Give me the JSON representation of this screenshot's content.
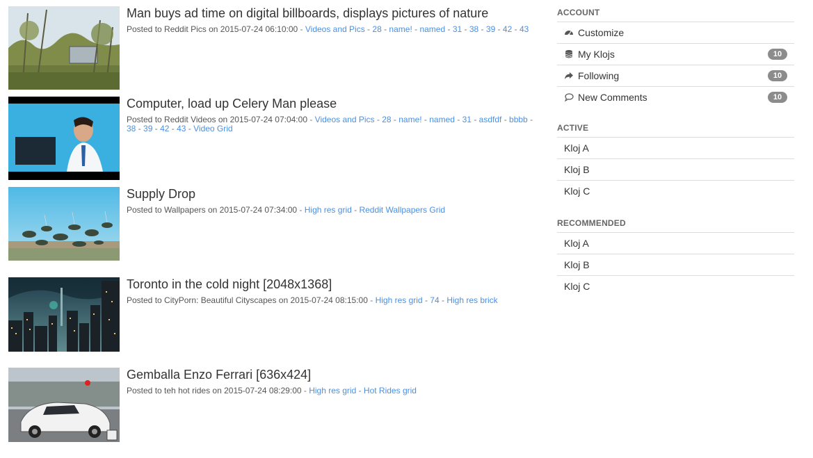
{
  "posts": [
    {
      "title": "Man buys ad time on digital billboards, displays pictures of nature",
      "posted_prefix": "Posted to ",
      "source": "Reddit Pics",
      "on_text": " on ",
      "timestamp": "2015-07-24 06:10:00",
      "tags": [
        "Videos and Pics",
        "28",
        "name!",
        "named",
        "31",
        "38",
        "39",
        "42",
        "43"
      ]
    },
    {
      "title": "Computer, load up Celery Man please",
      "posted_prefix": "Posted to ",
      "source": "Reddit Videos",
      "on_text": " on ",
      "timestamp": "2015-07-24 07:04:00",
      "tags": [
        "Videos and Pics",
        "28",
        "name!",
        "named",
        "31",
        "asdfdf",
        "bbbb",
        "38",
        "39",
        "42",
        "43",
        "Video Grid"
      ]
    },
    {
      "title": "Supply Drop",
      "posted_prefix": "Posted to ",
      "source": "Wallpapers",
      "on_text": " on ",
      "timestamp": "2015-07-24 07:34:00",
      "tags": [
        "High res grid",
        "Reddit Wallpapers Grid"
      ]
    },
    {
      "title": "Toronto in the cold night [2048x1368]",
      "posted_prefix": "Posted to ",
      "source": "CityPorn: Beautiful Cityscapes",
      "on_text": " on ",
      "timestamp": "2015-07-24 08:15:00",
      "tags": [
        "High res grid",
        "74",
        "High res brick"
      ]
    },
    {
      "title": "Gemballa Enzo Ferrari [636x424]",
      "posted_prefix": "Posted to ",
      "source": "teh hot rides",
      "on_text": " on ",
      "timestamp": "2015-07-24 08:29:00",
      "tags": [
        "High res grid",
        "Hot Rides grid"
      ]
    }
  ],
  "separator": " - ",
  "sidebar": {
    "account": {
      "title": "ACCOUNT",
      "items": [
        {
          "label": "Customize",
          "icon": "dashboard-icon"
        },
        {
          "label": "My Klojs",
          "icon": "database-icon",
          "badge": "10"
        },
        {
          "label": "Following",
          "icon": "share-arrow-icon",
          "badge": "10"
        },
        {
          "label": "New Comments",
          "icon": "comment-icon",
          "badge": "10"
        }
      ]
    },
    "active": {
      "title": "ACTIVE",
      "items": [
        "Kloj A",
        "Kloj B",
        "Kloj C"
      ]
    },
    "recommended": {
      "title": "RECOMMENDED",
      "items": [
        "Kloj A",
        "Kloj B",
        "Kloj C"
      ]
    }
  },
  "colors": {
    "link": "#4a90e2",
    "badge": "#8c8c8c",
    "divider": "#dddddd"
  }
}
